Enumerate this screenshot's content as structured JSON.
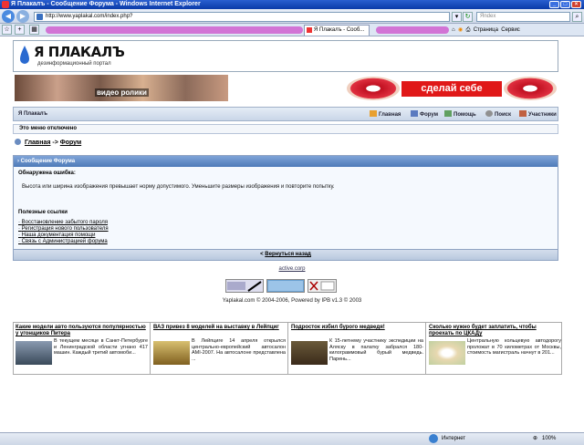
{
  "window": {
    "title": "Я Плакалъ - Сообщение Форума - Windows Internet Explorer",
    "min": "_",
    "max": "□",
    "close": "×"
  },
  "browser": {
    "address": "http://www.yaplakal.com/index.php?",
    "search_placeholder": "Яndex",
    "tab_title": "Я Плакалъ - Сооб...",
    "page_menu": "Страница",
    "tools_menu": "Сервис",
    "status_text": "Интернет",
    "zoom": "100%"
  },
  "site": {
    "logo_title": "Я ПЛАКАЛЪ",
    "logo_subtitle": "дезинформационный портал",
    "banner_left_text": "видео ролики",
    "banner_right_text": "сделай себе"
  },
  "nav": {
    "brand": "Я Плакалъ",
    "links": [
      "Главная",
      "Форум",
      "Помощь",
      "Поиск",
      "Участники"
    ]
  },
  "menu_notice": "Это меню отключено",
  "breadcrumb": {
    "home": "Главная",
    "sep": "->",
    "forum": "Форум"
  },
  "message": {
    "header": "Сообщение Форума",
    "error_title": "Обнаружена ошибка:",
    "error_text": "Высота или ширина изображения превышает норму допустимого. Уменьшите размеры изображения и повторите попытку.",
    "links_title": "Полезные ссылки",
    "links": [
      "Восстановление забытого пароля",
      "Регистрация нового пользователя",
      "Наша документация помощи",
      "Связь с Администрацией форума"
    ],
    "back": "Вернуться назад"
  },
  "footer": {
    "activecorp": "active.corp",
    "copyright": "Yaplakal.com © 2004-2006, Powered by IPB v1.3 © 2003"
  },
  "news": [
    {
      "title": "Какие модели авто пользуются популярностью у угонщиков Питера",
      "text": "В текущем месяце в Санкт-Петербурге и Ленинградской области угнано 417 машин. Каждый третий автомоби..."
    },
    {
      "title": "ВАЗ привез 8 моделей на выставку в Лейпциг",
      "text": "В Лейпциге 14 апреля открылся центрально-европейский автосалон AMI-2007. На автосалоне представлена ..."
    },
    {
      "title": "Подросток избил бурого медведя!",
      "text": "К 15-летнему участнику экспедиции на Аляску в палатку забрался 180-килограммовый бурый медведь. Парень..."
    },
    {
      "title": "Сколько нужно будет заплатить, чтобы проехать по ЦКАДу",
      "text": "Центральную кольцевую автодорогу проложат в 70 километрах от Москвы, стоимость магистраль начнут в 201..."
    }
  ]
}
